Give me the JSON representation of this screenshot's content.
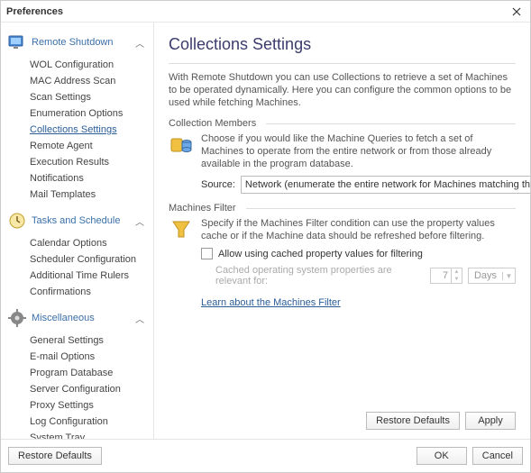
{
  "window": {
    "title": "Preferences"
  },
  "sidebar": {
    "sections": [
      {
        "name": "remote-shutdown",
        "label": "Remote Shutdown",
        "items": [
          {
            "label": "WOL Configuration"
          },
          {
            "label": "MAC Address Scan"
          },
          {
            "label": "Scan Settings"
          },
          {
            "label": "Enumeration Options"
          },
          {
            "label": "Collections Settings",
            "selected": true
          },
          {
            "label": "Remote Agent"
          },
          {
            "label": "Execution Results"
          },
          {
            "label": "Notifications"
          },
          {
            "label": "Mail Templates"
          }
        ]
      },
      {
        "name": "tasks-schedule",
        "label": "Tasks and Schedule",
        "items": [
          {
            "label": "Calendar Options"
          },
          {
            "label": "Scheduler Configuration"
          },
          {
            "label": "Additional Time Rulers"
          },
          {
            "label": "Confirmations"
          }
        ]
      },
      {
        "name": "miscellaneous",
        "label": "Miscellaneous",
        "items": [
          {
            "label": "General Settings"
          },
          {
            "label": "E-mail Options"
          },
          {
            "label": "Program Database"
          },
          {
            "label": "Server Configuration"
          },
          {
            "label": "Proxy Settings"
          },
          {
            "label": "Log Configuration"
          },
          {
            "label": "System Tray"
          }
        ]
      }
    ]
  },
  "content": {
    "heading": "Collections Settings",
    "description": "With Remote Shutdown you can use Collections to retrieve a set of Machines to be operated dynamically. Here you can configure the common options to be used while fetching Machines.",
    "collection_members": {
      "title": "Collection Members",
      "text": "Choose if you would like the Machine Queries to fetch a set of Machines to operate from the entire network or from those already available in the program database.",
      "source_label": "Source:",
      "source_value": "Network (enumerate the entire network for Machines matching the que..."
    },
    "machines_filter": {
      "title": "Machines Filter",
      "text": "Specify if the Machines Filter condition can use the property values cache or if the Machine data should be refreshed before filtering.",
      "checkbox_label": "Allow using cached property values for filtering",
      "cache_text": "Cached operating system properties are relevant for:",
      "cache_value": "7",
      "cache_unit": "Days",
      "link": "Learn about the Machines Filter"
    },
    "buttons": {
      "restore": "Restore Defaults",
      "apply": "Apply"
    }
  },
  "footer": {
    "restore": "Restore Defaults",
    "ok": "OK",
    "cancel": "Cancel"
  }
}
